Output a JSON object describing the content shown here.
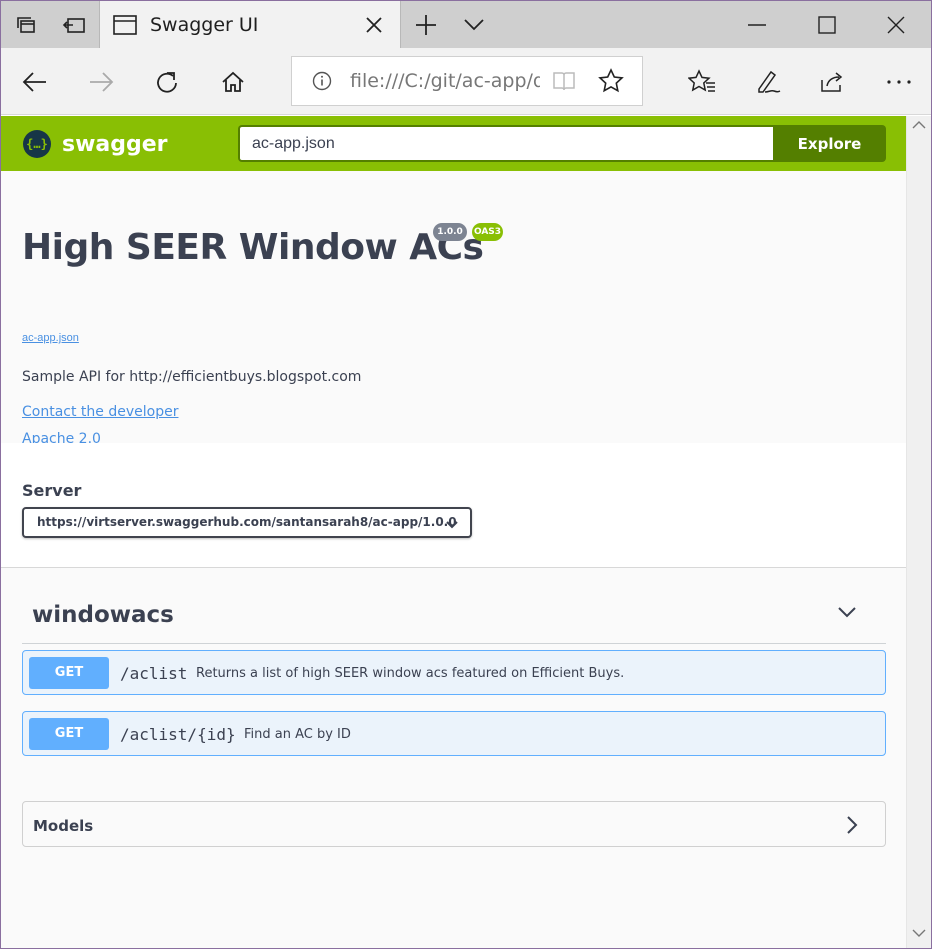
{
  "browser": {
    "tab_title": "Swagger UI",
    "address": "file:///C:/git/ac-app/d",
    "icons": [
      "tab-actions-icon",
      "set-aside-tabs-icon",
      "page-icon",
      "close-tab-icon",
      "new-tab-icon",
      "tab-list-icon",
      "minimize-icon",
      "maximize-icon",
      "close-window-icon",
      "back-icon",
      "forward-icon",
      "refresh-icon",
      "home-icon",
      "info-icon",
      "reading-view-icon",
      "favorite-star-icon",
      "favorites-hub-icon",
      "pen-icon",
      "share-icon",
      "more-icon"
    ]
  },
  "topbar": {
    "logo_text": "swagger",
    "logo_glyph": "{…}",
    "spec_url": "ac-app.json",
    "explore_label": "Explore"
  },
  "info": {
    "title": "High SEER Window ACs",
    "version_badge": "1.0.0",
    "oas_badge": "OAS3",
    "spec_link": "ac-app.json",
    "description": "Sample API for http://efficientbuys.blogspot.com",
    "contact": "Contact the developer",
    "license": "Apache 2.0"
  },
  "servers": {
    "label": "Server",
    "selected": "https://virtserver.swaggerhub.com/santansarah8/ac-app/1.0.0"
  },
  "tag": {
    "name": "windowacs",
    "operations": [
      {
        "method": "GET",
        "path": "/aclist",
        "summary": "Returns a list of high SEER window acs featured on Efficient Buys."
      },
      {
        "method": "GET",
        "path": "/aclist/{id}",
        "summary": "Find an AC by ID"
      }
    ]
  },
  "models": {
    "title": "Models"
  },
  "colors": {
    "swagger_green": "#89bf04",
    "explore_green": "#547f00",
    "get_blue": "#61affe",
    "get_bg": "#ebf3fb",
    "text": "#3b4151",
    "link": "#4990e2"
  }
}
